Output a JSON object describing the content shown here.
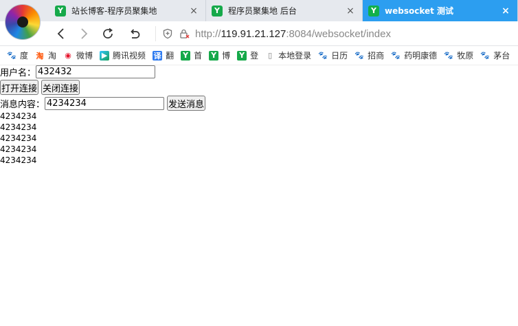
{
  "browser": {
    "tabs": [
      {
        "title": "站长博客-程序员聚集地",
        "favicon": "Y",
        "active": false
      },
      {
        "title": "程序员聚集地 后台",
        "favicon": "Y",
        "active": false
      },
      {
        "title": "websocket 测试",
        "favicon": "Y",
        "active": true
      }
    ],
    "close_glyph": "×",
    "url": {
      "scheme": "http://",
      "host": "119.91.21.127",
      "rest": ":8084/websocket/index"
    },
    "accent_color": "#2c9ef0"
  },
  "bookmarks": [
    {
      "label": "度",
      "icon": "paw-icon",
      "glyph": "🐾"
    },
    {
      "label": "淘",
      "icon": "taobao-icon",
      "glyph": "淘"
    },
    {
      "label": "微博",
      "icon": "weibo-icon",
      "glyph": "◉"
    },
    {
      "label": "腾讯视频",
      "icon": "video-icon",
      "glyph": "▶"
    },
    {
      "label": "翻",
      "icon": "translate-icon",
      "glyph": "译"
    },
    {
      "label": "首",
      "icon": "site-icon",
      "glyph": "Y"
    },
    {
      "label": "博",
      "icon": "site-icon",
      "glyph": "Y"
    },
    {
      "label": "登",
      "icon": "site-icon",
      "glyph": "Y"
    },
    {
      "label": "本地登录",
      "icon": "page-icon",
      "glyph": "▯"
    },
    {
      "label": "日历",
      "icon": "paw-icon",
      "glyph": "🐾"
    },
    {
      "label": "招商",
      "icon": "paw-icon",
      "glyph": "🐾"
    },
    {
      "label": "药明康德",
      "icon": "paw-icon",
      "glyph": "🐾"
    },
    {
      "label": "牧原",
      "icon": "paw-icon",
      "glyph": "🐾"
    },
    {
      "label": "茅台",
      "icon": "paw-icon",
      "glyph": "🐾"
    }
  ],
  "form": {
    "username_label": "用户名：",
    "username_value": "432432",
    "open_button": "打开连接",
    "close_button": "关闭连接",
    "message_label": "消息内容：",
    "message_value": "4234234",
    "send_button": "发送消息"
  },
  "messages": [
    "4234234",
    "4234234",
    "4234234",
    "4234234",
    "4234234"
  ]
}
